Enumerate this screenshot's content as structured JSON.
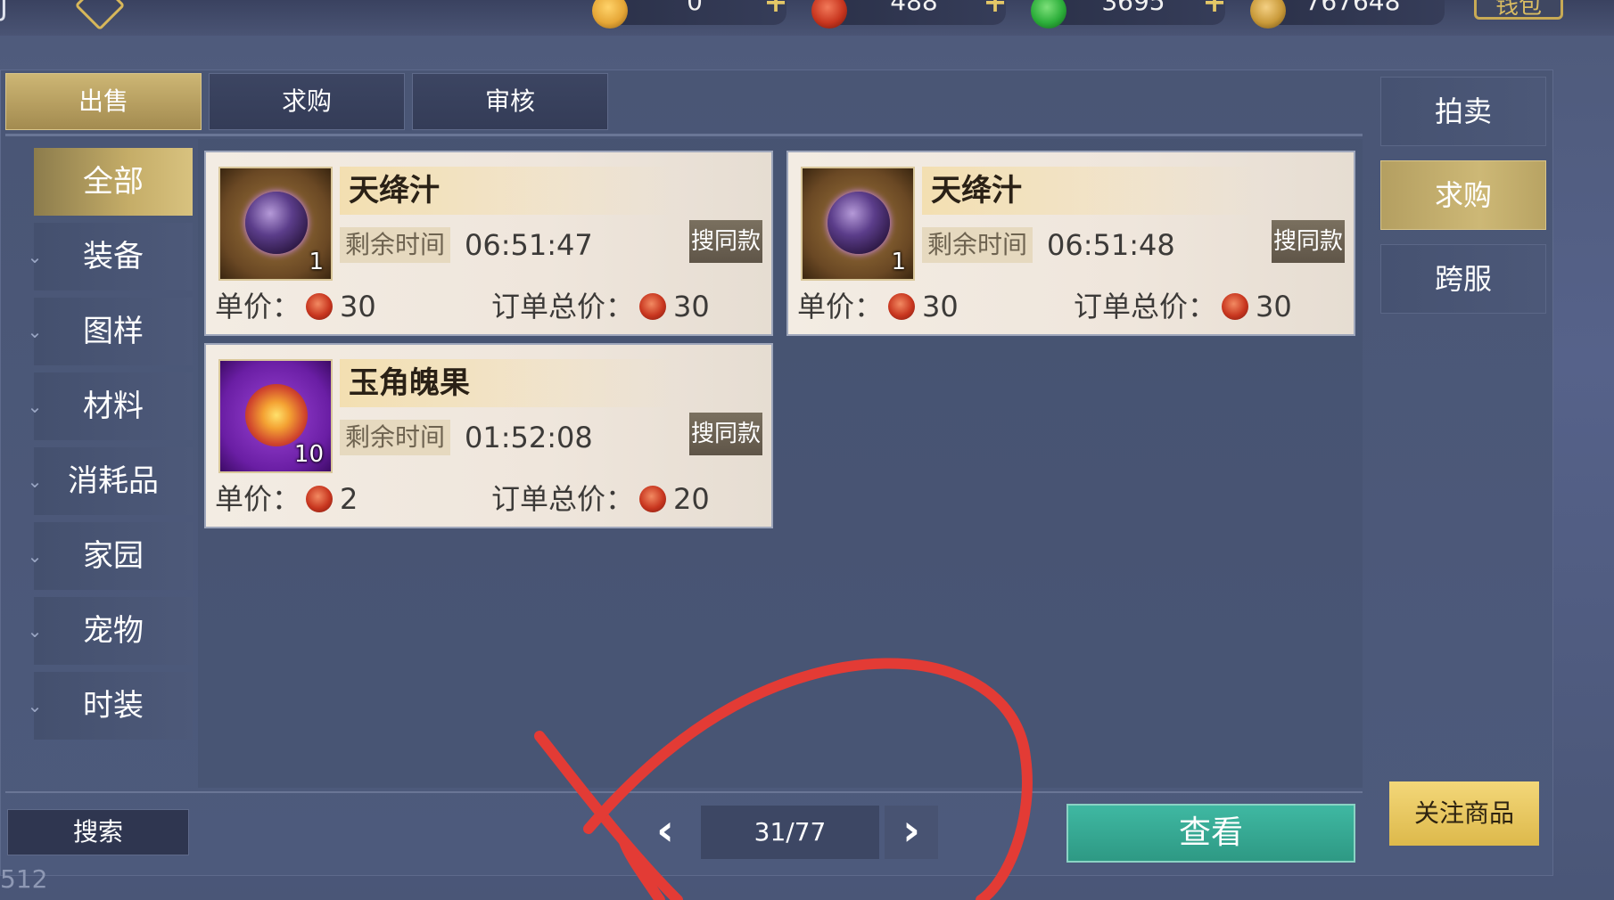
{
  "top_bar": {
    "left_mark": "J",
    "bag_label": "钱包",
    "currencies": [
      {
        "icon": "gold-coin-icon",
        "value": "0",
        "color": "#e6a737"
      },
      {
        "icon": "red-gem-icon",
        "value": "488",
        "color": "#c8361f"
      },
      {
        "icon": "jade-icon",
        "value": "3695",
        "color": "#2cae3a"
      },
      {
        "icon": "ingot-icon",
        "value": "767648",
        "color": "#c99a3a"
      }
    ]
  },
  "tabs": [
    {
      "label": "出售",
      "active": true
    },
    {
      "label": "求购",
      "active": false
    },
    {
      "label": "审核",
      "active": false
    }
  ],
  "categories": [
    {
      "label": "全部",
      "active": true
    },
    {
      "label": "装备"
    },
    {
      "label": "图样"
    },
    {
      "label": "材料"
    },
    {
      "label": "消耗品"
    },
    {
      "label": "家园"
    },
    {
      "label": "宠物"
    },
    {
      "label": "时装"
    }
  ],
  "listings": [
    {
      "name": "天绛汁",
      "quantity": "1",
      "time_label": "剩余时间",
      "time": "06:51:47",
      "search_label": "搜同款",
      "unit_label": "单价：",
      "unit_price": "30",
      "total_label": "订单总价：",
      "total_price": "30"
    },
    {
      "name": "天绛汁",
      "quantity": "1",
      "time_label": "剩余时间",
      "time": "06:51:48",
      "search_label": "搜同款",
      "unit_label": "单价：",
      "unit_price": "30",
      "total_label": "订单总价：",
      "total_price": "30"
    },
    {
      "name": "玉角魄果",
      "quantity": "10",
      "time_label": "剩余时间",
      "time": "01:52:08",
      "search_label": "搜同款",
      "unit_label": "单价：",
      "unit_price": "2",
      "total_label": "订单总价：",
      "total_price": "20"
    }
  ],
  "side_menu": [
    {
      "label": "拍卖",
      "active": false
    },
    {
      "label": "求购",
      "active": true
    },
    {
      "label": "跨服",
      "active": false
    }
  ],
  "follow_label": "关注商品",
  "search_label": "搜索",
  "pagination": {
    "current": "31/77"
  },
  "view_label": "查看",
  "bottom_left_number": "512",
  "annotation_color": "#e33b35"
}
